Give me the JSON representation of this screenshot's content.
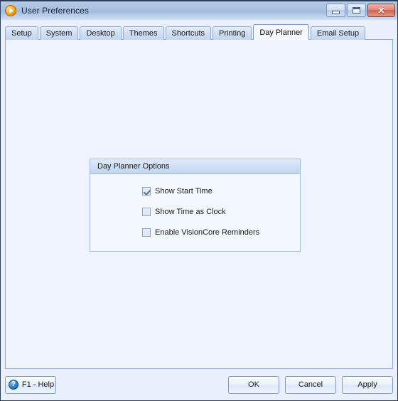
{
  "window": {
    "title": "User Preferences",
    "app_icon": "play-circle-icon",
    "controls": {
      "minimize": "minimize-icon",
      "maximize": "maximize-icon",
      "close": "✕"
    }
  },
  "tabs": [
    {
      "label": "Setup",
      "active": false
    },
    {
      "label": "System",
      "active": false
    },
    {
      "label": "Desktop",
      "active": false
    },
    {
      "label": "Themes",
      "active": false
    },
    {
      "label": "Shortcuts",
      "active": false
    },
    {
      "label": "Printing",
      "active": false
    },
    {
      "label": "Day Planner",
      "active": true
    },
    {
      "label": "Email Setup",
      "active": false
    }
  ],
  "groupbox": {
    "title": "Day Planner Options",
    "options": [
      {
        "label": "Show Start Time",
        "checked": true
      },
      {
        "label": "Show Time as Clock",
        "checked": false
      },
      {
        "label": "Enable VisionCore Reminders",
        "checked": false
      }
    ]
  },
  "footer": {
    "help_label": "F1 - Help",
    "help_icon": "?",
    "ok_label": "OK",
    "cancel_label": "Cancel",
    "apply_label": "Apply"
  },
  "colors": {
    "window_border": "#2b3f5c",
    "titlebar_gradient_start": "#b9cce6",
    "titlebar_gradient_end": "#cfe0f4",
    "panel_background": "#eff3fd",
    "tab_border": "#8fabd0",
    "active_tab_background": "#f4f8fe",
    "close_button": "#cc6450",
    "accent_icon_orange": "#f0a81e",
    "help_icon_blue": "#2a7fcc"
  }
}
